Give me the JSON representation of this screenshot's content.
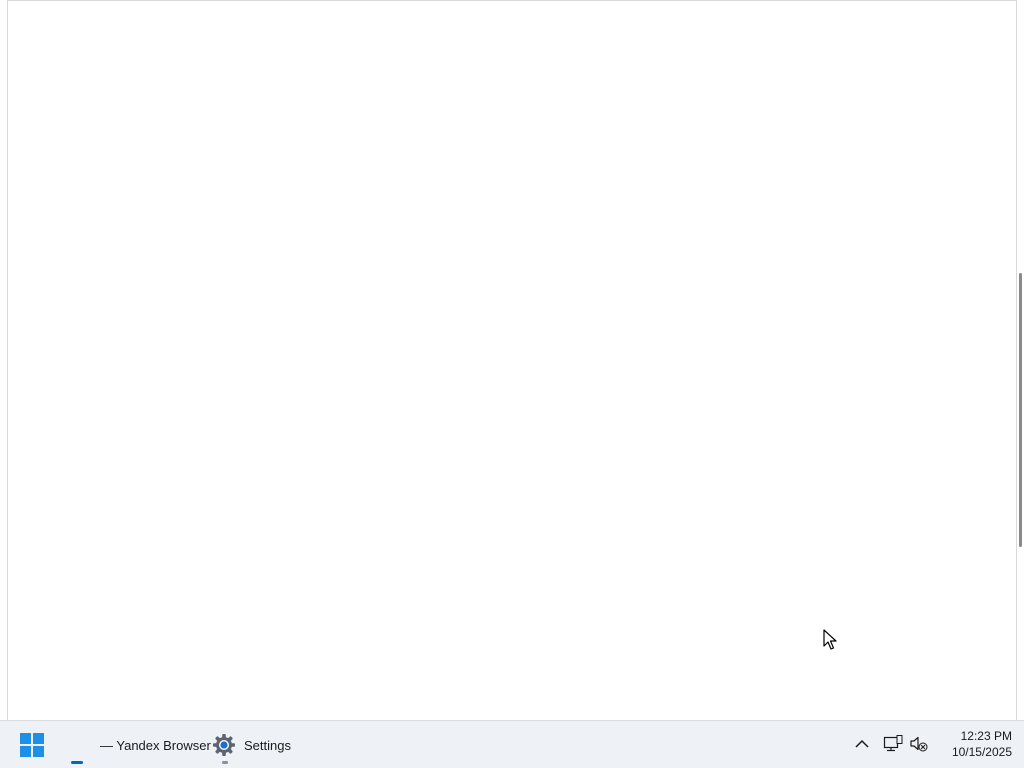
{
  "window": {
    "scrollbar": {
      "position_fraction": 0.38,
      "thumb_fraction": 0.38
    }
  },
  "taskbar": {
    "start": {
      "icon": "windows-logo-icon"
    },
    "apps": [
      {
        "icon": "blank-window-icon",
        "label": "",
        "active": true
      },
      {
        "icon": "yandex-browser-icon",
        "label": "— Yandex Browser",
        "active": false
      },
      {
        "icon": "gear-icon",
        "label": "Settings",
        "active": false
      }
    ],
    "tray": {
      "overflow_icon": "chevron-up-icon",
      "network_icon": "network-icon",
      "volume_icon": "volume-muted-icon"
    },
    "clock": {
      "time": "12:23 PM",
      "date": "10/15/2025"
    }
  },
  "colors": {
    "accent": "#0067c0",
    "taskbar_bg": "#eef1f6",
    "window_bg": "#ffffff"
  }
}
